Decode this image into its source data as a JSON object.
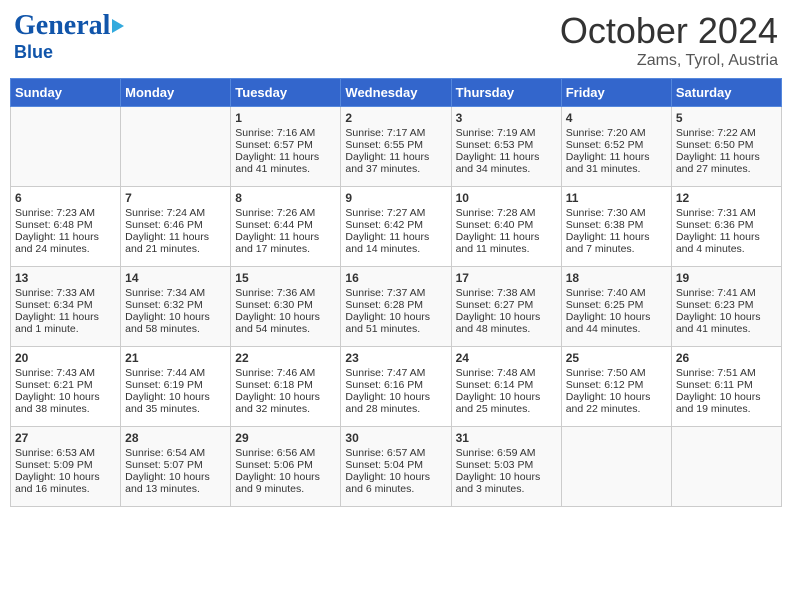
{
  "header": {
    "logo_general": "General",
    "logo_blue": "Blue",
    "month": "October 2024",
    "location": "Zams, Tyrol, Austria"
  },
  "columns": [
    "Sunday",
    "Monday",
    "Tuesday",
    "Wednesday",
    "Thursday",
    "Friday",
    "Saturday"
  ],
  "weeks": [
    {
      "days": [
        {
          "num": "",
          "sunrise": "",
          "sunset": "",
          "daylight": ""
        },
        {
          "num": "",
          "sunrise": "",
          "sunset": "",
          "daylight": ""
        },
        {
          "num": "1",
          "sunrise": "Sunrise: 7:16 AM",
          "sunset": "Sunset: 6:57 PM",
          "daylight": "Daylight: 11 hours and 41 minutes."
        },
        {
          "num": "2",
          "sunrise": "Sunrise: 7:17 AM",
          "sunset": "Sunset: 6:55 PM",
          "daylight": "Daylight: 11 hours and 37 minutes."
        },
        {
          "num": "3",
          "sunrise": "Sunrise: 7:19 AM",
          "sunset": "Sunset: 6:53 PM",
          "daylight": "Daylight: 11 hours and 34 minutes."
        },
        {
          "num": "4",
          "sunrise": "Sunrise: 7:20 AM",
          "sunset": "Sunset: 6:52 PM",
          "daylight": "Daylight: 11 hours and 31 minutes."
        },
        {
          "num": "5",
          "sunrise": "Sunrise: 7:22 AM",
          "sunset": "Sunset: 6:50 PM",
          "daylight": "Daylight: 11 hours and 27 minutes."
        }
      ]
    },
    {
      "days": [
        {
          "num": "6",
          "sunrise": "Sunrise: 7:23 AM",
          "sunset": "Sunset: 6:48 PM",
          "daylight": "Daylight: 11 hours and 24 minutes."
        },
        {
          "num": "7",
          "sunrise": "Sunrise: 7:24 AM",
          "sunset": "Sunset: 6:46 PM",
          "daylight": "Daylight: 11 hours and 21 minutes."
        },
        {
          "num": "8",
          "sunrise": "Sunrise: 7:26 AM",
          "sunset": "Sunset: 6:44 PM",
          "daylight": "Daylight: 11 hours and 17 minutes."
        },
        {
          "num": "9",
          "sunrise": "Sunrise: 7:27 AM",
          "sunset": "Sunset: 6:42 PM",
          "daylight": "Daylight: 11 hours and 14 minutes."
        },
        {
          "num": "10",
          "sunrise": "Sunrise: 7:28 AM",
          "sunset": "Sunset: 6:40 PM",
          "daylight": "Daylight: 11 hours and 11 minutes."
        },
        {
          "num": "11",
          "sunrise": "Sunrise: 7:30 AM",
          "sunset": "Sunset: 6:38 PM",
          "daylight": "Daylight: 11 hours and 7 minutes."
        },
        {
          "num": "12",
          "sunrise": "Sunrise: 7:31 AM",
          "sunset": "Sunset: 6:36 PM",
          "daylight": "Daylight: 11 hours and 4 minutes."
        }
      ]
    },
    {
      "days": [
        {
          "num": "13",
          "sunrise": "Sunrise: 7:33 AM",
          "sunset": "Sunset: 6:34 PM",
          "daylight": "Daylight: 11 hours and 1 minute."
        },
        {
          "num": "14",
          "sunrise": "Sunrise: 7:34 AM",
          "sunset": "Sunset: 6:32 PM",
          "daylight": "Daylight: 10 hours and 58 minutes."
        },
        {
          "num": "15",
          "sunrise": "Sunrise: 7:36 AM",
          "sunset": "Sunset: 6:30 PM",
          "daylight": "Daylight: 10 hours and 54 minutes."
        },
        {
          "num": "16",
          "sunrise": "Sunrise: 7:37 AM",
          "sunset": "Sunset: 6:28 PM",
          "daylight": "Daylight: 10 hours and 51 minutes."
        },
        {
          "num": "17",
          "sunrise": "Sunrise: 7:38 AM",
          "sunset": "Sunset: 6:27 PM",
          "daylight": "Daylight: 10 hours and 48 minutes."
        },
        {
          "num": "18",
          "sunrise": "Sunrise: 7:40 AM",
          "sunset": "Sunset: 6:25 PM",
          "daylight": "Daylight: 10 hours and 44 minutes."
        },
        {
          "num": "19",
          "sunrise": "Sunrise: 7:41 AM",
          "sunset": "Sunset: 6:23 PM",
          "daylight": "Daylight: 10 hours and 41 minutes."
        }
      ]
    },
    {
      "days": [
        {
          "num": "20",
          "sunrise": "Sunrise: 7:43 AM",
          "sunset": "Sunset: 6:21 PM",
          "daylight": "Daylight: 10 hours and 38 minutes."
        },
        {
          "num": "21",
          "sunrise": "Sunrise: 7:44 AM",
          "sunset": "Sunset: 6:19 PM",
          "daylight": "Daylight: 10 hours and 35 minutes."
        },
        {
          "num": "22",
          "sunrise": "Sunrise: 7:46 AM",
          "sunset": "Sunset: 6:18 PM",
          "daylight": "Daylight: 10 hours and 32 minutes."
        },
        {
          "num": "23",
          "sunrise": "Sunrise: 7:47 AM",
          "sunset": "Sunset: 6:16 PM",
          "daylight": "Daylight: 10 hours and 28 minutes."
        },
        {
          "num": "24",
          "sunrise": "Sunrise: 7:48 AM",
          "sunset": "Sunset: 6:14 PM",
          "daylight": "Daylight: 10 hours and 25 minutes."
        },
        {
          "num": "25",
          "sunrise": "Sunrise: 7:50 AM",
          "sunset": "Sunset: 6:12 PM",
          "daylight": "Daylight: 10 hours and 22 minutes."
        },
        {
          "num": "26",
          "sunrise": "Sunrise: 7:51 AM",
          "sunset": "Sunset: 6:11 PM",
          "daylight": "Daylight: 10 hours and 19 minutes."
        }
      ]
    },
    {
      "days": [
        {
          "num": "27",
          "sunrise": "Sunrise: 6:53 AM",
          "sunset": "Sunset: 5:09 PM",
          "daylight": "Daylight: 10 hours and 16 minutes."
        },
        {
          "num": "28",
          "sunrise": "Sunrise: 6:54 AM",
          "sunset": "Sunset: 5:07 PM",
          "daylight": "Daylight: 10 hours and 13 minutes."
        },
        {
          "num": "29",
          "sunrise": "Sunrise: 6:56 AM",
          "sunset": "Sunset: 5:06 PM",
          "daylight": "Daylight: 10 hours and 9 minutes."
        },
        {
          "num": "30",
          "sunrise": "Sunrise: 6:57 AM",
          "sunset": "Sunset: 5:04 PM",
          "daylight": "Daylight: 10 hours and 6 minutes."
        },
        {
          "num": "31",
          "sunrise": "Sunrise: 6:59 AM",
          "sunset": "Sunset: 5:03 PM",
          "daylight": "Daylight: 10 hours and 3 minutes."
        },
        {
          "num": "",
          "sunrise": "",
          "sunset": "",
          "daylight": ""
        },
        {
          "num": "",
          "sunrise": "",
          "sunset": "",
          "daylight": ""
        }
      ]
    }
  ]
}
